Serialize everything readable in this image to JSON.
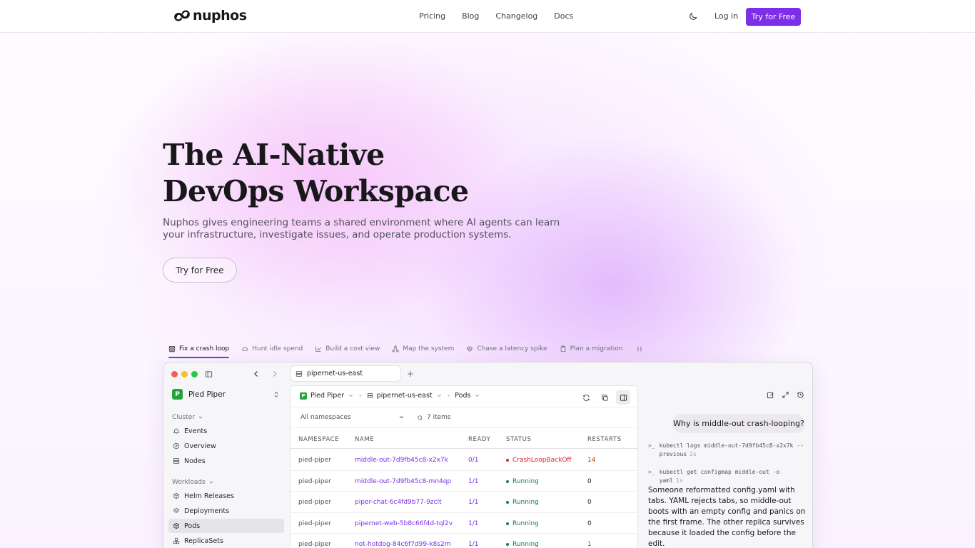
{
  "nav": {
    "brand": "nuphos",
    "links": [
      "Pricing",
      "Blog",
      "Changelog",
      "Docs"
    ],
    "login": "Log in",
    "cta": "Try for Free"
  },
  "hero": {
    "title_line1": "The AI-Native",
    "title_line2": "DevOps Workspace",
    "subtitle": "Nuphos gives engineering teams a shared environment where AI agents can learn your infrastructure, investigate issues, and operate production systems.",
    "cta": "Try for Free"
  },
  "scenarios": {
    "active_index": 0,
    "tabs": [
      {
        "label": "Fix a crash loop",
        "icon": "layers-icon"
      },
      {
        "label": "Hunt idle spend",
        "icon": "cloud-icon"
      },
      {
        "label": "Build a cost view",
        "icon": "chart-icon"
      },
      {
        "label": "Map the system",
        "icon": "network-icon"
      },
      {
        "label": "Chase a latency spike",
        "icon": "heart-pulse-icon"
      },
      {
        "label": "Plan a migration",
        "icon": "clipboard-icon"
      }
    ]
  },
  "window": {
    "tab_title": "pipernet-us-east",
    "org_name": "Pied Piper",
    "org_badge": "P",
    "groups": {
      "cluster": "Cluster",
      "workloads": "Workloads"
    },
    "cluster_items": [
      "Events",
      "Overview",
      "Nodes"
    ],
    "workload_items": [
      "Helm Releases",
      "Deployments",
      "Pods",
      "ReplicaSets"
    ],
    "active_item": "Pods",
    "breadcrumb": {
      "org": "Pied Piper",
      "cluster": "pipernet-us-east",
      "resource": "Pods"
    },
    "filter": {
      "namespace": "All namespaces",
      "count": "7 items"
    },
    "table": {
      "headers": [
        "NAMESPACE",
        "NAME",
        "READY",
        "STATUS",
        "RESTARTS"
      ],
      "rows": [
        {
          "ns": "pied-piper",
          "name": "middle-out-7d9fb45c8-x2x7k",
          "ready": "0/1",
          "status": "CrashLoopBackOff",
          "restarts": "14",
          "status_color": "#dc2626",
          "restart_color": "#c2410c"
        },
        {
          "ns": "pied-piper",
          "name": "middle-out-7d9fb45c8-mn4qp",
          "ready": "1/1",
          "status": "Running",
          "restarts": "0",
          "status_color": "#15803d",
          "restart_color": "#27272a"
        },
        {
          "ns": "pied-piper",
          "name": "piper-chat-6c4fd9b77-9zclt",
          "ready": "1/1",
          "status": "Running",
          "restarts": "0",
          "status_color": "#15803d",
          "restart_color": "#27272a"
        },
        {
          "ns": "pied-piper",
          "name": "pipernet-web-5b8c66f4d-tql2v",
          "ready": "1/1",
          "status": "Running",
          "restarts": "0",
          "status_color": "#15803d",
          "restart_color": "#27272a"
        },
        {
          "ns": "pied-piper",
          "name": "not-hotdog-84c6f7d99-k8s2m",
          "ready": "1/1",
          "status": "Running",
          "restarts": "1",
          "status_color": "#15803d",
          "restart_color": "#c2410c"
        }
      ]
    },
    "chat": {
      "question": "Why is middle-out crash-looping?",
      "commands": [
        {
          "text": "kubectl logs middle-out-7d9fb45c8-x2x7k --previous",
          "duration": "2s"
        },
        {
          "text": "kubectl get configmap middle-out -o yaml",
          "duration": "1s"
        }
      ],
      "answer": "Someone reformatted config.yaml with tabs. YAML rejects tabs, so middle-out boots with an empty config and panics on the first frame. The other replica survives because it loaded the config before the edit."
    }
  },
  "colors": {
    "accent": "#7c2ee8",
    "running": "#15803d",
    "crash": "#dc2626",
    "restart_warn": "#c2410c"
  }
}
